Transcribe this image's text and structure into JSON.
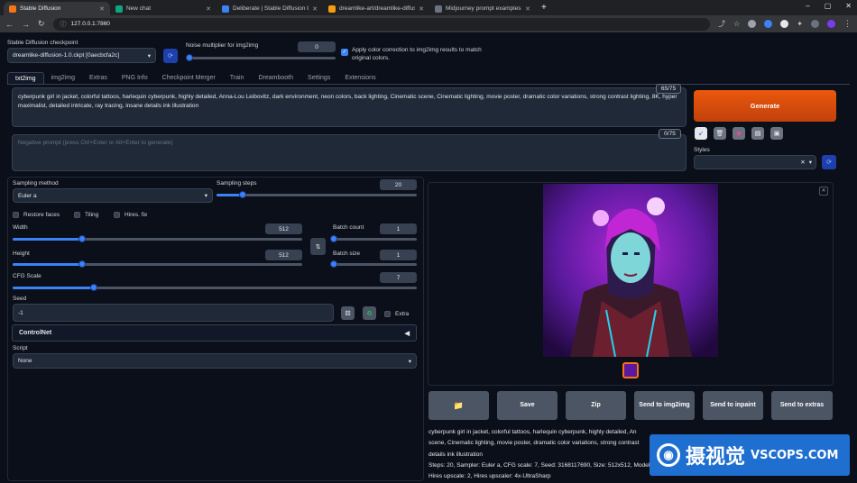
{
  "browser": {
    "tabs": [
      {
        "title": "Stable Diffusion",
        "active": true,
        "color": "#f97316"
      },
      {
        "title": "New chat",
        "active": false,
        "color": "#10a37f"
      },
      {
        "title": "Deliberate | Stable Diffusion Che",
        "active": false,
        "color": "#3b82f6"
      },
      {
        "title": "dreamlike-art/dreamlike-diffusio",
        "active": false,
        "color": "#f59e0b"
      },
      {
        "title": "Midjourney prompt examples (1",
        "active": false,
        "color": "#6b7280"
      }
    ],
    "url": "127.0.0.1:7860"
  },
  "checkpoint": {
    "label": "Stable Diffusion checkpoint",
    "value": "dreamlike-diffusion-1.0.ckpt [0aecbcfa2c]"
  },
  "noise": {
    "label": "Noise multiplier for img2img",
    "value": "0"
  },
  "color_correction": {
    "label": "Apply color correction to img2img results to match original colors.",
    "checked": true
  },
  "tabs": [
    "txt2img",
    "img2img",
    "Extras",
    "PNG Info",
    "Checkpoint Merger",
    "Train",
    "Dreambooth",
    "Settings",
    "Extensions"
  ],
  "prompt": {
    "text": "cyberpunk girl in jacket, colorful tattoos, harlequin cyberpunk, highly detailed, Anna-Lou Leibovitz, dark environment, neon colors, back lighting, Cinematic scene, Cinematic lighting, movie poster, dramatic color variations, strong contrast lighting, 8K, hyper maximalist, detailed intricate, ray tracing, insane details ink illustration",
    "token_count": "65/75"
  },
  "negative_prompt": {
    "placeholder": "Negative prompt (press Ctrl+Enter or Alt+Enter to generate)",
    "token_count": "0/75"
  },
  "generate_label": "Generate",
  "styles_label": "Styles",
  "sampling_method": {
    "label": "Sampling method",
    "value": "Euler a"
  },
  "sampling_steps": {
    "label": "Sampling steps",
    "value": "20",
    "fraction": 0.13
  },
  "checkboxes": {
    "restore_faces": "Restore faces",
    "tiling": "Tiling",
    "hires_fix": "Hires. fix"
  },
  "width": {
    "label": "Width",
    "value": "512",
    "fraction": 0.24
  },
  "height": {
    "label": "Height",
    "value": "512",
    "fraction": 0.24
  },
  "batch_count": {
    "label": "Batch count",
    "value": "1",
    "fraction": 0.01
  },
  "batch_size": {
    "label": "Batch size",
    "value": "1",
    "fraction": 0.01
  },
  "cfg_scale": {
    "label": "CFG Scale",
    "value": "7",
    "fraction": 0.2
  },
  "seed": {
    "label": "Seed",
    "value": "-1",
    "extra_label": "Extra"
  },
  "controlnet_label": "ControlNet",
  "script": {
    "label": "Script",
    "value": "None"
  },
  "output_buttons": [
    "Zip",
    "Send to img2img",
    "Send to inpaint",
    "Send to extras"
  ],
  "save_label": "Save",
  "info": {
    "line1": "cyberpunk girl in jacket, colorful tattoos, harlequin cyberpunk, highly detailed, An",
    "line2": "scene, Cinematic lighting, movie poster, dramatic color variations, strong contrast",
    "line3": "details ink illustration",
    "line4": "Steps: 20, Sampler: Euler a, CFG scale: 7, Seed: 3168117690, Size: 512x512, Model",
    "line5": "Hires upscale: 2, Hires upscaler: 4x-UltraSharp"
  },
  "watermark": {
    "text": "摄视觉",
    "site": "VSCOPS.COM"
  }
}
